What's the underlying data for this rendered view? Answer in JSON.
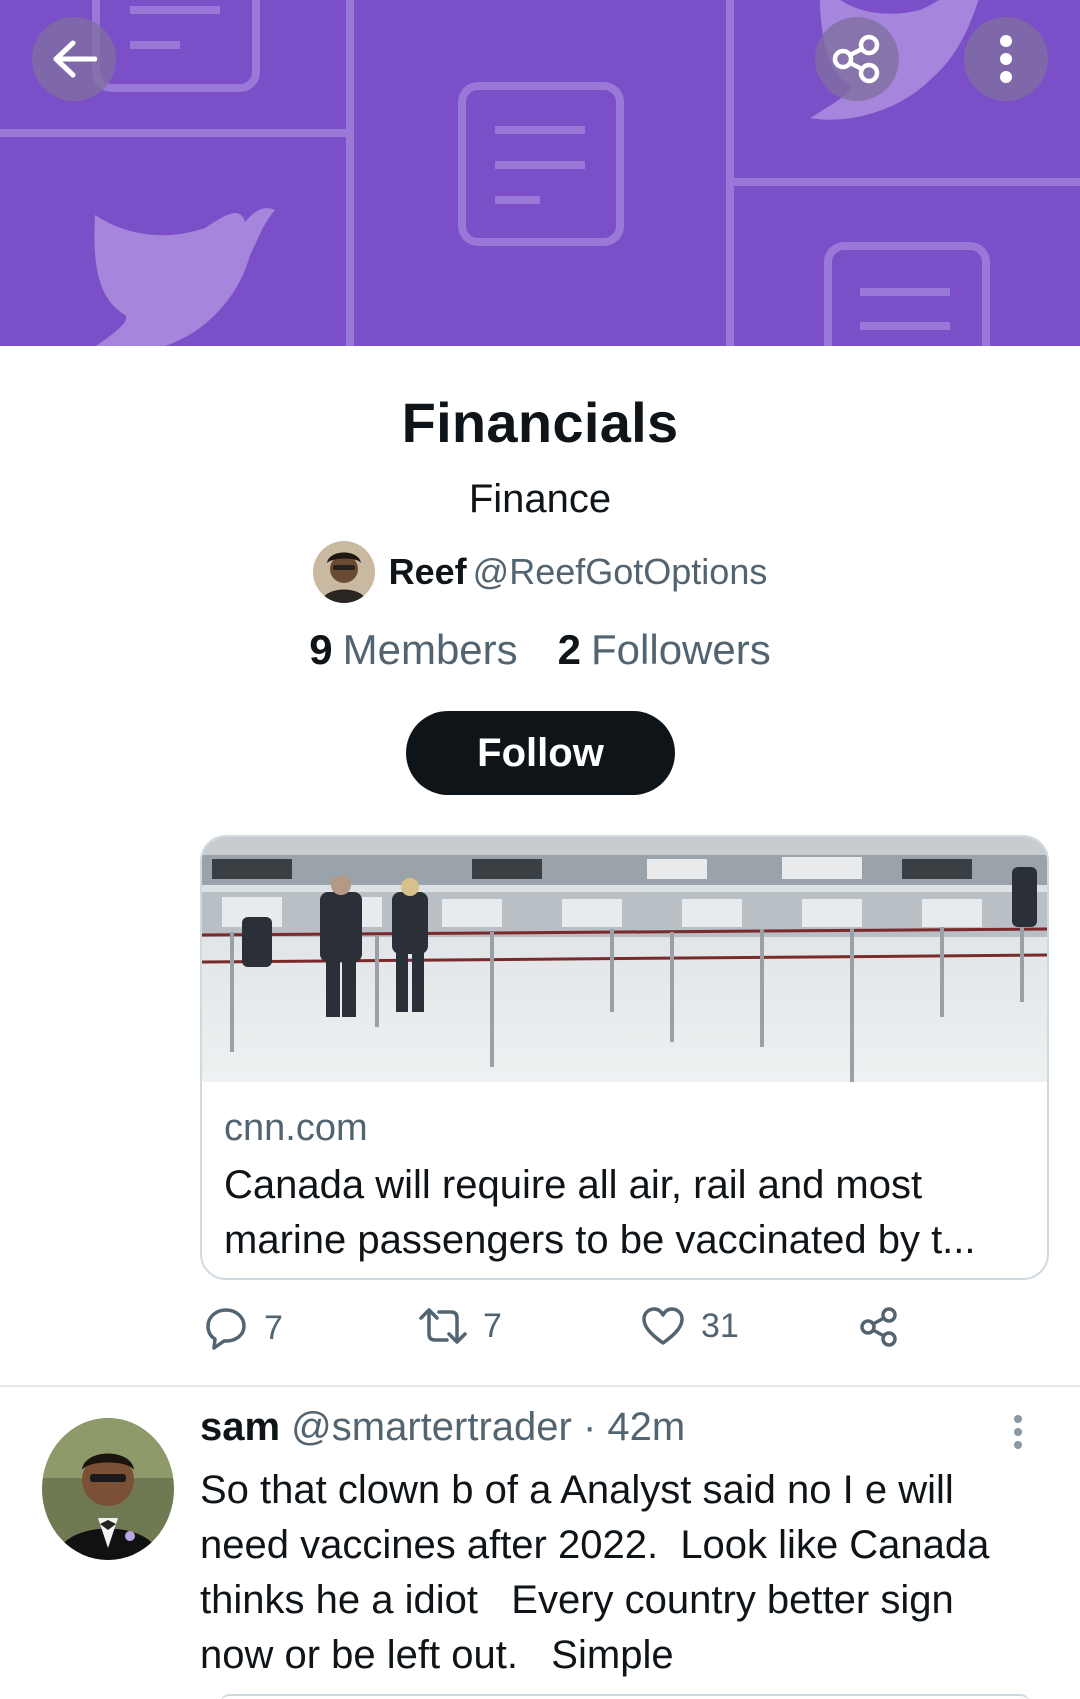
{
  "colors": {
    "banner": "#7b4fc7",
    "follow_button": "#0f1419",
    "secondary_text": "#536471",
    "border": "#cfd9de"
  },
  "header": {
    "back_icon": "arrow-left-icon",
    "share_icon": "share-icon",
    "more_icon": "more-vertical-icon"
  },
  "list": {
    "title": "Financials",
    "topic": "Finance",
    "owner_name": "Reef",
    "owner_handle": "@ReefGotOptions",
    "members_count": "9",
    "members_label": "Members",
    "followers_count": "2",
    "followers_label": "Followers",
    "follow_label": "Follow"
  },
  "link_card": {
    "domain": "cnn.com",
    "title_line1": "Canada will require all air, rail and most",
    "title_line2": "marine passengers to be vaccinated by t..."
  },
  "actions": {
    "replies": "7",
    "retweets": "7",
    "likes": "31",
    "icons": [
      "reply-icon",
      "retweet-icon",
      "like-icon",
      "share-icon"
    ]
  },
  "tweet": {
    "name": "sam",
    "handle_time": " @smartertrader · 42m",
    "lines": [
      "So that clown b of a Analyst said no I e will",
      "need vaccines after 2022.  Look like Canada",
      "thinks he a idiot   Every country better sign",
      "now or be left out.   Simple"
    ]
  }
}
